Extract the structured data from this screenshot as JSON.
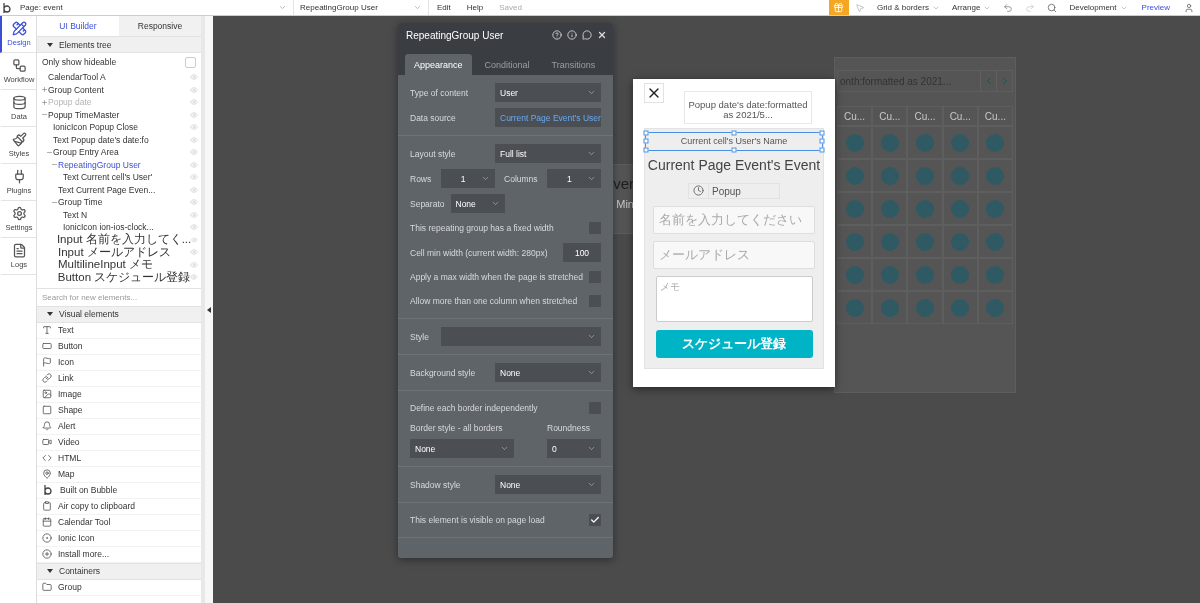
{
  "topbar": {
    "page_select": "Page: event",
    "element_select": "RepeatingGroup User",
    "menu": [
      "Edit",
      "Help"
    ],
    "status": "Saved",
    "tools": [
      "Grid & borders",
      "Arrange"
    ],
    "environment": "Development",
    "preview": "Preview"
  },
  "rail": [
    {
      "label": "Design",
      "kind": "design",
      "selected": true
    },
    {
      "label": "Workflow",
      "kind": "workflow",
      "selected": false
    },
    {
      "label": "Data",
      "kind": "data",
      "selected": false
    },
    {
      "label": "Styles",
      "kind": "styles",
      "selected": false
    },
    {
      "label": "Plugins",
      "kind": "plugins",
      "selected": false
    },
    {
      "label": "Settings",
      "kind": "settings",
      "selected": false
    },
    {
      "label": "Logs",
      "kind": "logs",
      "selected": false
    }
  ],
  "panel_tabs": [
    {
      "label": "UI Builder",
      "selected": true
    },
    {
      "label": "Responsive",
      "selected": false
    }
  ],
  "elements_tree": {
    "title": "Elements tree",
    "expanded": true,
    "filter": {
      "label": "Only show hideable",
      "checked": false
    },
    "items": [
      {
        "label": "CalendarTool A",
        "selected": false
      },
      {
        "label": "Group Content",
        "selected": false,
        "expanded": false
      },
      {
        "label": "Popup date",
        "selected": false,
        "expanded": false,
        "hidden": true
      },
      {
        "label": "Popup TimeMaster",
        "selected": false,
        "expanded": true,
        "children": [
          {
            "label": "IonicIcon Popup Close",
            "selected": false
          },
          {
            "label": "Text Popup date's date:fo",
            "selected": false
          },
          {
            "label": "Group Entry Area",
            "selected": false,
            "expanded": true,
            "children": [
              {
                "label": "RepeatingGroup User",
                "selected": true,
                "expanded": true,
                "children": [
                  {
                    "label": "Text Current cell's User'",
                    "selected": false
                  }
                ]
              },
              {
                "label": "Text Current Page Even...",
                "selected": false
              },
              {
                "label": "Group Time",
                "selected": false,
                "expanded": true,
                "children": [
                  {
                    "label": "Text N",
                    "selected": false
                  },
                  {
                    "label": "IonicIcon ion-ios-clock...",
                    "selected": false
                  }
                ]
              },
              {
                "label": "Input 名前を入力してく...",
                "selected": false
              },
              {
                "label": "Input メールアドレス",
                "selected": false
              },
              {
                "label": "MultilineInput メモ",
                "selected": false
              },
              {
                "label": "Button スケジュール登録",
                "selected": false
              }
            ]
          }
        ]
      }
    ]
  },
  "search": {
    "placeholder": "Search for new elements..."
  },
  "visual_elements": {
    "title": "Visual elements",
    "expanded": true,
    "items": [
      {
        "label": "Text",
        "kind": "text"
      },
      {
        "label": "Button",
        "kind": "button"
      },
      {
        "label": "Icon",
        "kind": "icon"
      },
      {
        "label": "Link",
        "kind": "link"
      },
      {
        "label": "Image",
        "kind": "image"
      },
      {
        "label": "Shape",
        "kind": "shape"
      },
      {
        "label": "Alert",
        "kind": "alert"
      },
      {
        "label": "Video",
        "kind": "video"
      },
      {
        "label": "HTML",
        "kind": "html"
      },
      {
        "label": "Map",
        "kind": "map"
      },
      {
        "label": "Built on Bubble",
        "kind": "bubble"
      },
      {
        "label": "Air copy to clipboard",
        "kind": "clipboard"
      },
      {
        "label": "Calendar Tool",
        "kind": "calendar"
      },
      {
        "label": "Ionic Icon",
        "kind": "ionic"
      },
      {
        "label": "Install more...",
        "kind": "install"
      }
    ]
  },
  "containers": {
    "title": "Containers",
    "expanded": true,
    "items": [
      {
        "label": "Group",
        "kind": "group"
      }
    ]
  },
  "property_editor": {
    "title": "RepeatingGroup User",
    "tabs": [
      {
        "label": "Appearance",
        "selected": true
      },
      {
        "label": "Conditional",
        "selected": false
      },
      {
        "label": "Transitions",
        "selected": false
      }
    ],
    "sections": [
      [
        {
          "kind": "select",
          "label": "Type of content",
          "value": "User"
        },
        {
          "kind": "link",
          "label": "Data source",
          "value": "Current Page Event's User"
        }
      ],
      [
        {
          "kind": "select",
          "label": "Layout style",
          "value": "Full list"
        },
        {
          "kind": "pair",
          "items": [
            {
              "label": "Rows",
              "value": "1"
            },
            {
              "label": "Columns",
              "value": "1"
            }
          ]
        },
        {
          "kind": "small_select",
          "label": "Separato",
          "value": "None"
        },
        {
          "kind": "checkbox",
          "label": "This repeating group has a fixed width",
          "checked": false
        },
        {
          "kind": "number",
          "label": "Cell min width (current width: 280px)",
          "value": "100"
        },
        {
          "kind": "checkbox",
          "label": "Apply a max width when the page is stretched",
          "checked": false
        },
        {
          "kind": "checkbox",
          "label": "Allow more than one column when stretched",
          "checked": false
        }
      ],
      [
        {
          "kind": "wide_select",
          "label": "Style"
        }
      ],
      [
        {
          "kind": "select",
          "label": "Background style",
          "value": "None"
        }
      ],
      [
        {
          "kind": "checkbox",
          "label": "Define each border independently",
          "checked": false
        },
        {
          "kind": "stacked",
          "items": [
            {
              "label": "Border style - all borders",
              "value": "None"
            },
            {
              "label": "Roundness",
              "value": "0"
            }
          ]
        }
      ],
      [
        {
          "kind": "select",
          "label": "Shadow style",
          "value": "None"
        }
      ],
      [
        {
          "kind": "checkbox",
          "label": "This element is visible on page load",
          "checked": true
        }
      ]
    ]
  },
  "background_page": {
    "fragments": [
      "ver",
      "Min"
    ],
    "calendar": {
      "month_label": "onth:formatted as 2021...",
      "column_headers": [
        "Cu...",
        "Cu...",
        "Cu...",
        "Cu...",
        "Cu..."
      ]
    }
  },
  "popup": {
    "date_text": "Popup date's date:formatted as 2021/5...",
    "user_name": {
      "text": "Current cell's User's Name",
      "selected": true
    },
    "event_name": "Current Page Event's Event",
    "time_label": "Popup",
    "inputs": [
      {
        "kind": "input",
        "placeholder": "名前を入力してください"
      },
      {
        "kind": "input",
        "placeholder": "メールアドレス"
      },
      {
        "kind": "multiline",
        "placeholder": "メモ"
      }
    ],
    "submit": "スケジュール登録"
  }
}
